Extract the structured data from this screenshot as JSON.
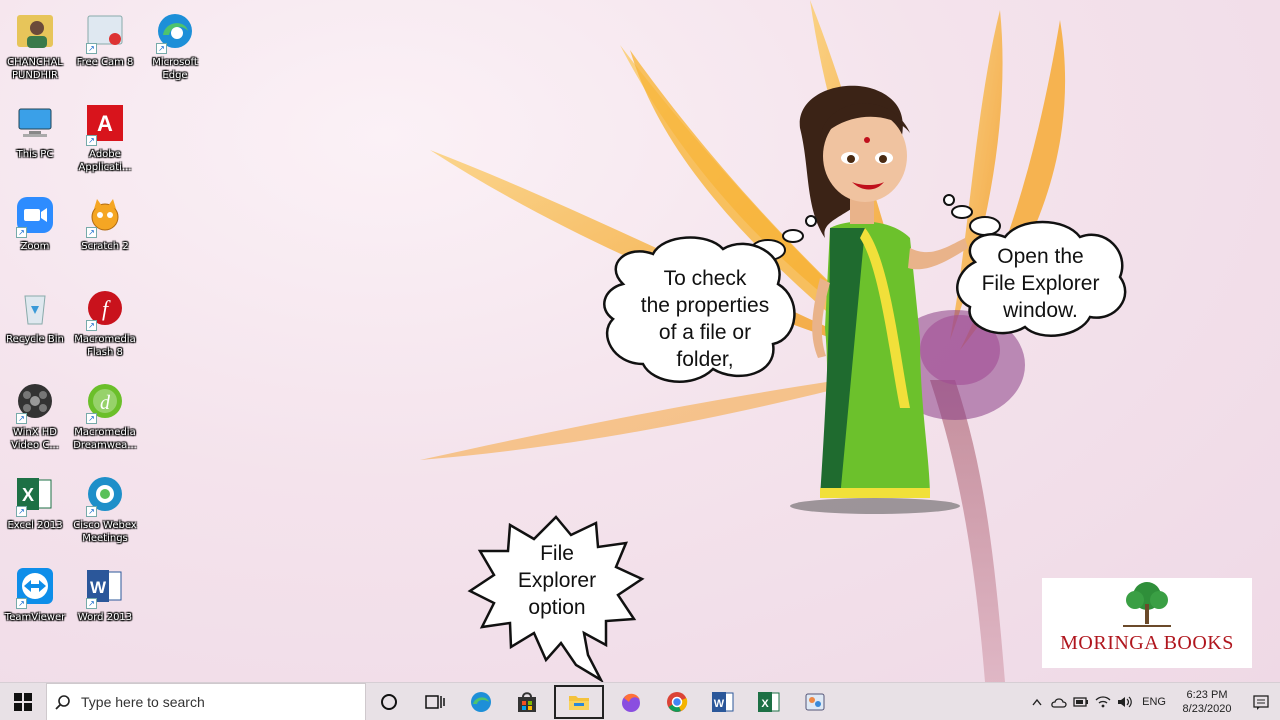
{
  "desktop_icons": [
    {
      "label": "CHANCHAL\nPUNDHIR",
      "icon": "user-folder-icon"
    },
    {
      "label": "Free Cam 8",
      "icon": "free-cam-icon"
    },
    {
      "label": "Microsoft\nEdge",
      "icon": "edge-icon"
    },
    {
      "label": "This PC",
      "icon": "this-pc-icon"
    },
    {
      "label": "Adobe\nApplicati...",
      "icon": "adobe-icon"
    },
    {
      "label": "Zoom",
      "icon": "zoom-icon"
    },
    {
      "label": "Scratch 2",
      "icon": "scratch-icon"
    },
    {
      "label": "Recycle Bin",
      "icon": "recycle-bin-icon"
    },
    {
      "label": "Macromedia\nFlash 8",
      "icon": "flash-icon"
    },
    {
      "label": "WinX HD\nVideo C...",
      "icon": "winx-icon"
    },
    {
      "label": "Macromedia\nDreamwea...",
      "icon": "dreamweaver-icon"
    },
    {
      "label": "Excel 2013",
      "icon": "excel-icon"
    },
    {
      "label": "Cisco Webex\nMeetings",
      "icon": "webex-icon"
    },
    {
      "label": "TeamViewer",
      "icon": "teamviewer-icon"
    },
    {
      "label": "Word 2013",
      "icon": "word-icon"
    }
  ],
  "bubbles": {
    "left": "To check\nthe properties\nof a file or\nfolder,",
    "right": "Open the\nFile Explorer\nwindow.",
    "bottom": "File\nExplorer\noption"
  },
  "logo": {
    "brand": "MORINGA BOOKS"
  },
  "taskbar": {
    "search_placeholder": "Type here to search",
    "pinned": [
      "cortana-icon",
      "task-view-icon",
      "edge-icon",
      "store-icon",
      "file-explorer-icon",
      "firefox-icon",
      "chrome-icon",
      "word-icon",
      "excel-icon",
      "paint-icon"
    ],
    "lang": "ENG",
    "time": "6:23 PM",
    "date": "8/23/2020"
  },
  "colors": {
    "accent": "#0078d7",
    "brand_red": "#b0161e",
    "saree_green": "#5fb32e",
    "flower_orange": "#f6a829"
  }
}
